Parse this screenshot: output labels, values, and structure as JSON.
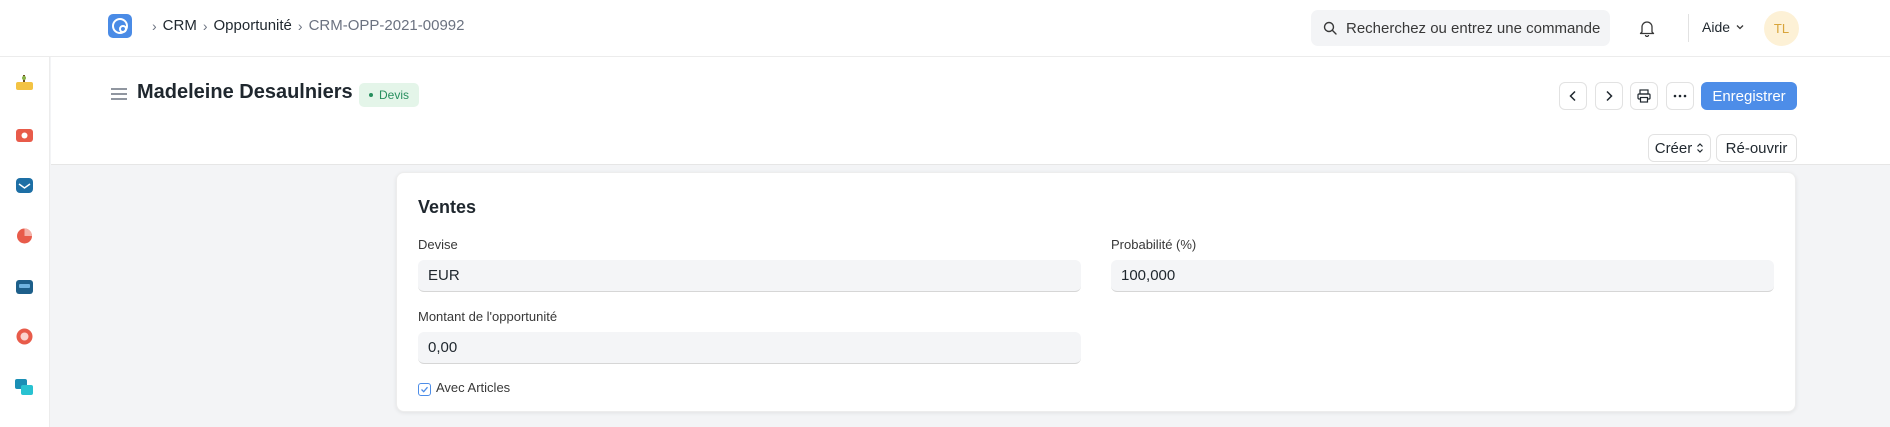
{
  "navbar": {
    "breadcrumbs": [
      "CRM",
      "Opportunité"
    ],
    "current": "CRM-OPP-2021-00992",
    "search_placeholder": "Recherchez ou entrez une commande",
    "help_label": "Aide",
    "avatar_initials": "TL"
  },
  "header": {
    "title": "Madeleine Desaulniers",
    "status": "Devis",
    "save_label": "Enregistrer",
    "create_label": "Créer",
    "reopen_label": "Ré-ouvrir"
  },
  "section": {
    "title": "Ventes",
    "fields": {
      "currency_label": "Devise",
      "currency_value": "EUR",
      "probability_label": "Probabilité (%)",
      "probability_value": "100,000",
      "amount_label": "Montant de l'opportunité",
      "amount_value": "0,00",
      "with_items_label": "Avec Articles"
    }
  },
  "colors": {
    "primary": "#4d8de8",
    "status_green": "#278f5e",
    "status_bg": "#e4f5e9"
  }
}
